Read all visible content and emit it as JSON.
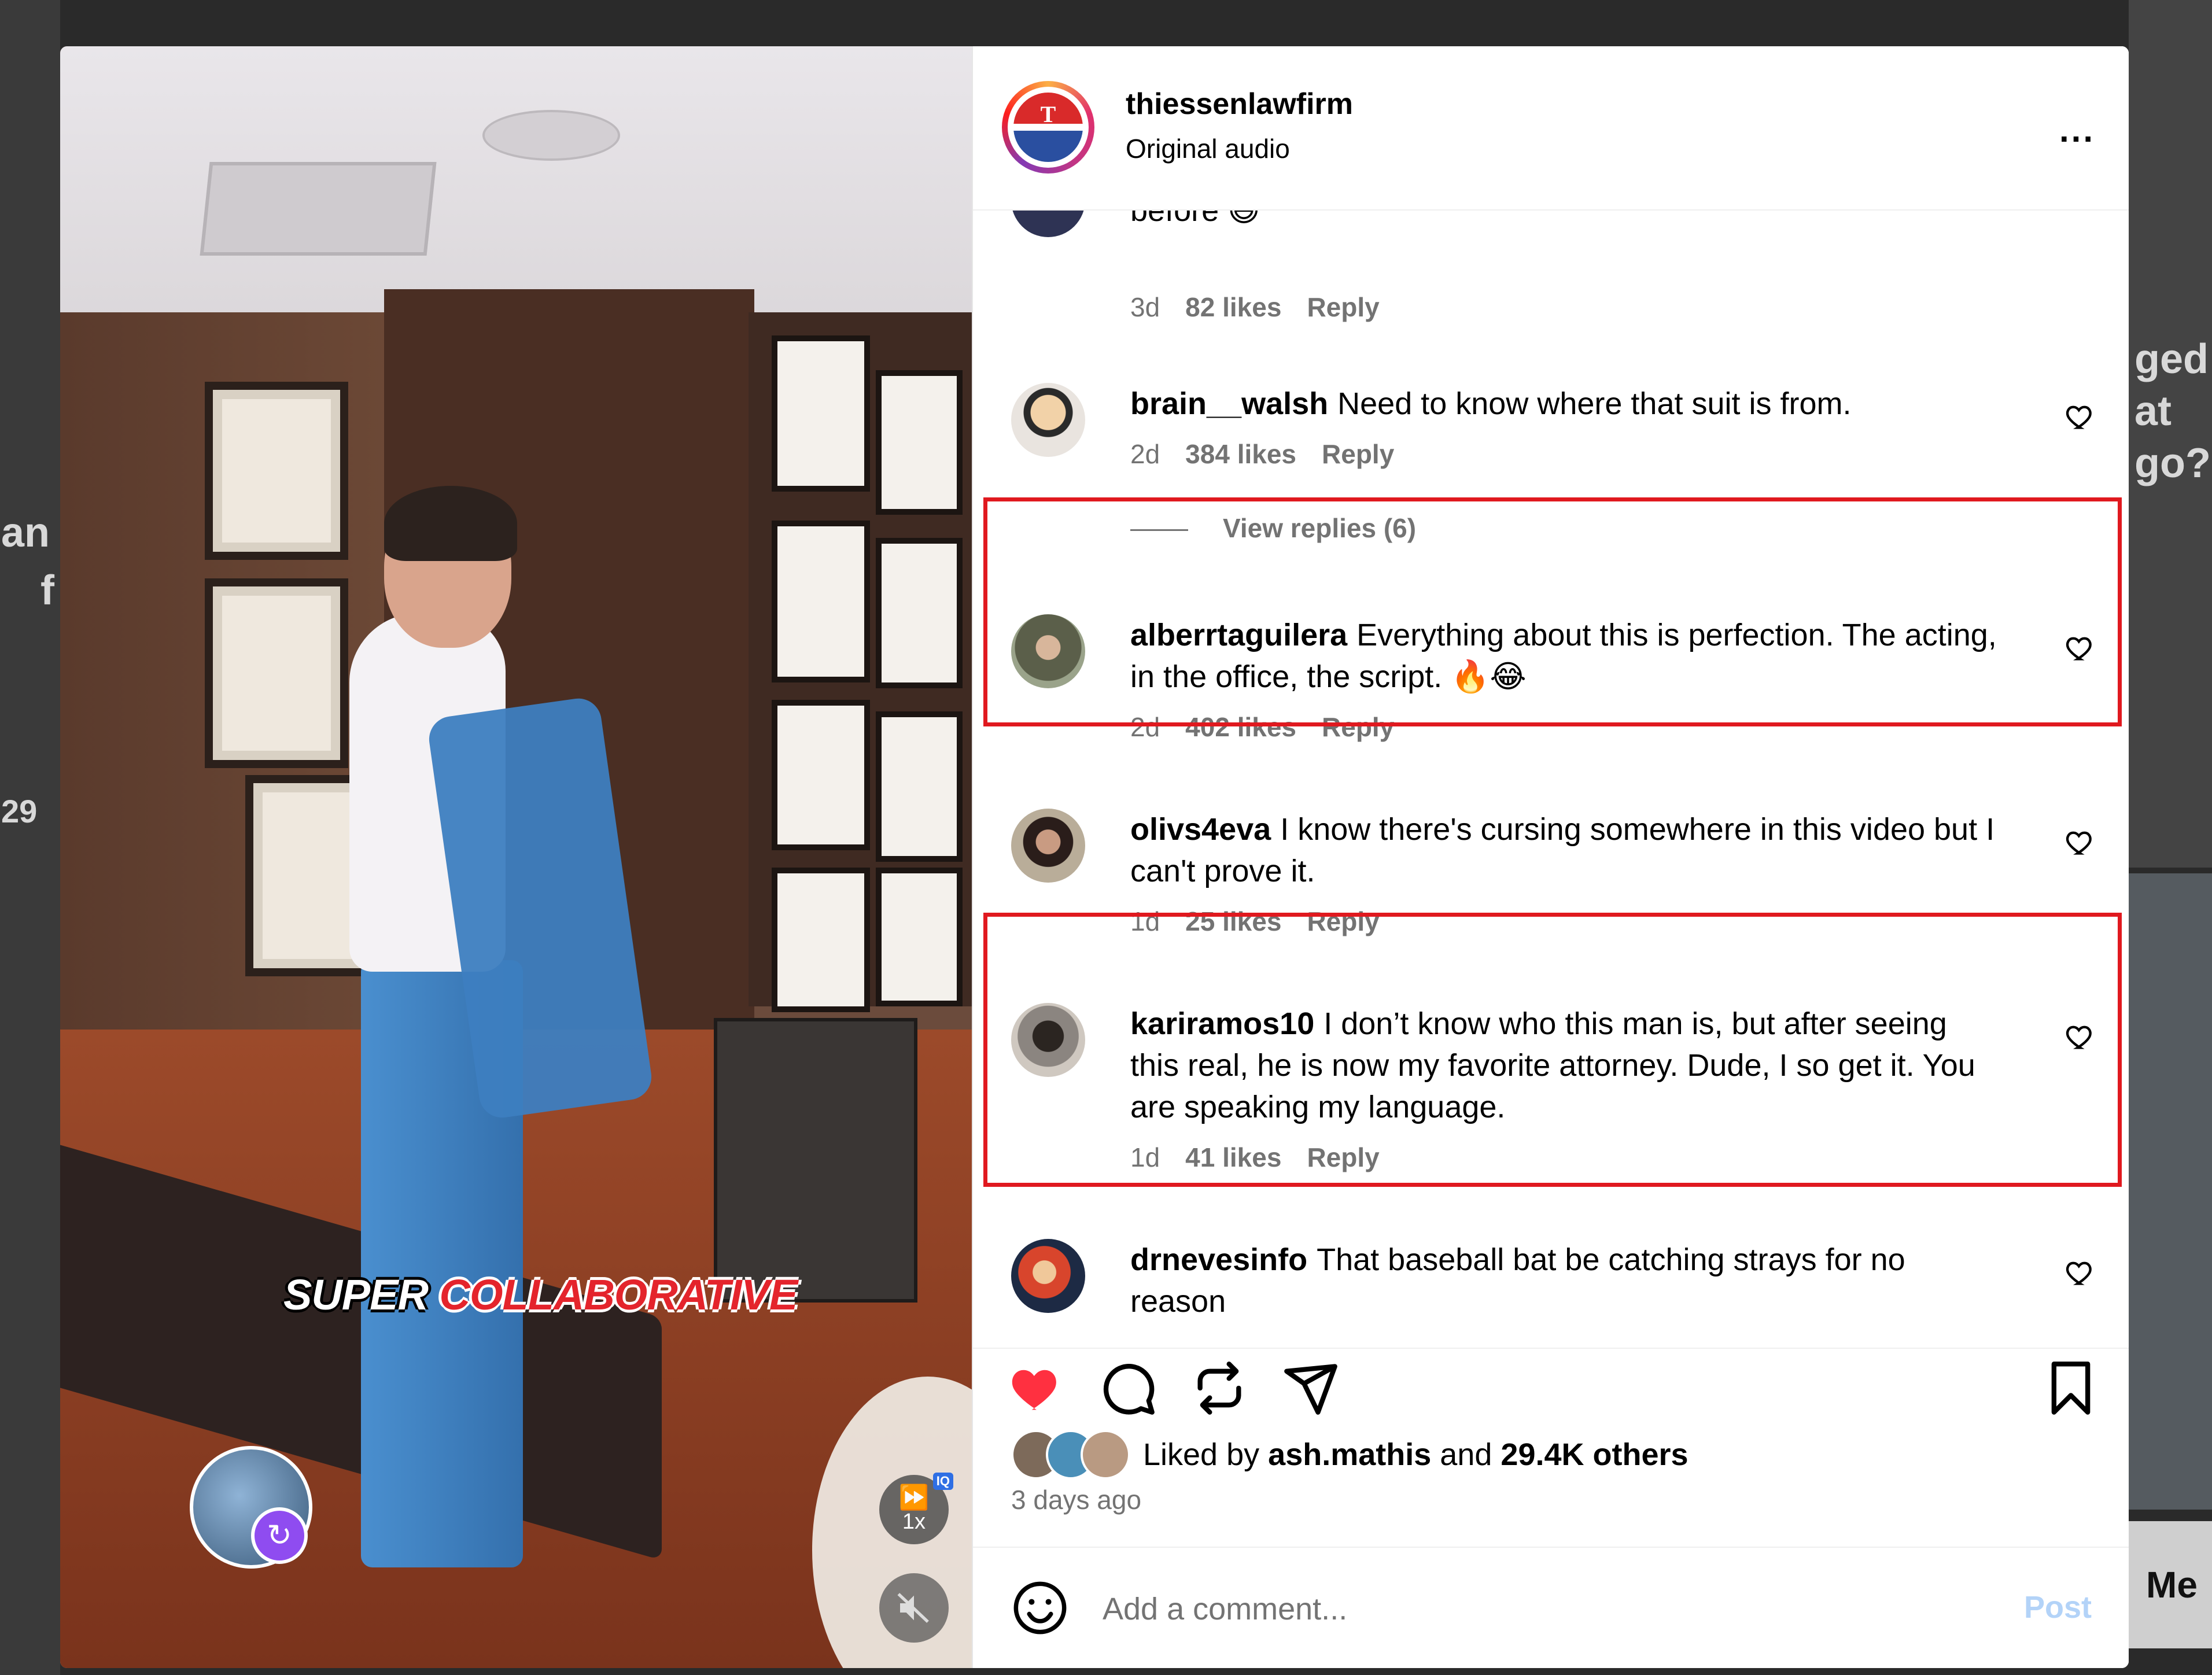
{
  "background": {
    "left_fragment_1": "an",
    "left_fragment_2": "f",
    "left_fragment_3": "29",
    "right_fragment_1": "ged",
    "right_fragment_2": "at",
    "right_fragment_3": "go?",
    "message_fragment": "Me"
  },
  "video": {
    "caption_word1": "SUPER",
    "caption_word2": "COLLABORATIVE",
    "speed_label": "1x",
    "speed_badge": "IQ",
    "icons": [
      "repost-icon",
      "fast-forward-icon",
      "mute-icon"
    ]
  },
  "header": {
    "username": "thiessenlawfirm",
    "audio": "Original audio",
    "more_label": "..."
  },
  "partial_comment": {
    "text": "before 😅",
    "time": "3d",
    "likes": "82 likes",
    "reply": "Reply"
  },
  "comments": [
    {
      "username": "brain__walsh",
      "text": "Need to know where that suit is from.",
      "time": "2d",
      "likes": "384 likes",
      "reply": "Reply",
      "avatar_color": "#d9b37a"
    },
    {
      "username": "alberrtaguilera",
      "text": "Everything about this is perfection. The acting, in the office, the script. 🔥😂",
      "time": "2d",
      "likes": "402 likes",
      "reply": "Reply",
      "avatar_color": "#6f7a5c"
    },
    {
      "username": "olivs4eva",
      "text": "I know there's cursing somewhere in this video but I can't prove it.",
      "time": "1d",
      "likes": "25 likes",
      "reply": "Reply",
      "avatar_color": "#8a7a6a"
    },
    {
      "username": "kariramos10",
      "text": "I don’t know who this man is, but after seeing this real, he is now my favorite attorney. Dude, I so get it. You are speaking my language.",
      "time": "1d",
      "likes": "41 likes",
      "reply": "Reply",
      "avatar_color": "#9a9290"
    },
    {
      "username": "drnevesinfo",
      "text": "That baseball bat be catching strays for no reason",
      "time": "",
      "likes": "",
      "reply": "",
      "avatar_color": "#c8402a"
    }
  ],
  "view_replies": "View replies (6)",
  "actions": {
    "icons": [
      "heart-filled-icon",
      "comment-icon",
      "repost-icon",
      "share-icon",
      "bookmark-icon"
    ],
    "liked_prefix": "Liked by",
    "liked_user": "ash.mathis",
    "liked_and": "and",
    "liked_others": "29.4K others",
    "time_ago": "3 days ago"
  },
  "composer": {
    "placeholder": "Add a comment...",
    "post_label": "Post"
  },
  "colors": {
    "highlight": "#e0191f",
    "heart": "#ff3040",
    "post_disabled": "#b3d3f8",
    "muted_text": "#737373"
  }
}
